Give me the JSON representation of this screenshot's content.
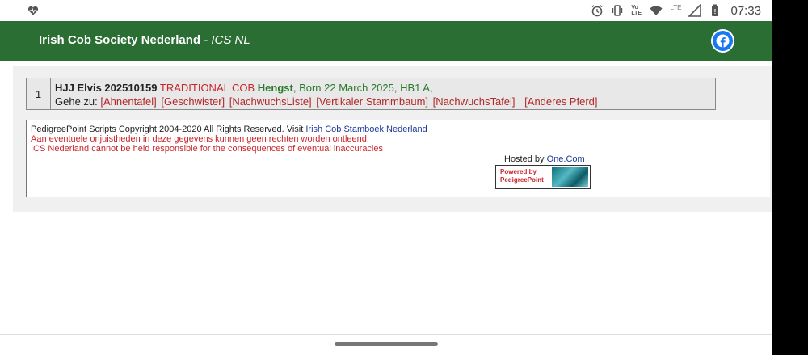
{
  "status_bar": {
    "time": "07:33",
    "lte_label": "LTE",
    "volte_label": "Vo LTE"
  },
  "header": {
    "title_main": "Irish Cob Society Nederland",
    "title_sub": " - ICS NL",
    "facebook_icon": "facebook-icon",
    "bg_color": "#2b6e34"
  },
  "horse_row": {
    "number": "1",
    "name": "HJJ Elvis 202510159",
    "breed": "TRADITIONAL COB",
    "sex": "Hengst",
    "born": ", Born 22 March 2025, HB1 A,",
    "goto_label": "Gehe zu:",
    "links": [
      "[Ahnentafel]",
      "[Geschwister]",
      "[NachwuchsListe]",
      "[Vertikaler Stammbaum]",
      "[NachwuchsTafel]",
      "[Anderes Pferd]"
    ]
  },
  "footer": {
    "copyright": "PedigreePoint Scripts Copyright 2004-2020 All Rights Reserved. Visit ",
    "copyright_link": "Irish Cob Stamboek Nederland",
    "disclaimer_nl": "Aan eventuele onjuistheden in deze gegevens kunnen geen rechten worden ontleend.",
    "disclaimer_en": "ICS Nederland cannot be held responsible for the consequences of eventual inaccuracies",
    "hosted_label": "Hosted by ",
    "hosted_link": "One.Com",
    "badge_line1": "Powered by",
    "badge_line2": "PedigreePoint"
  }
}
